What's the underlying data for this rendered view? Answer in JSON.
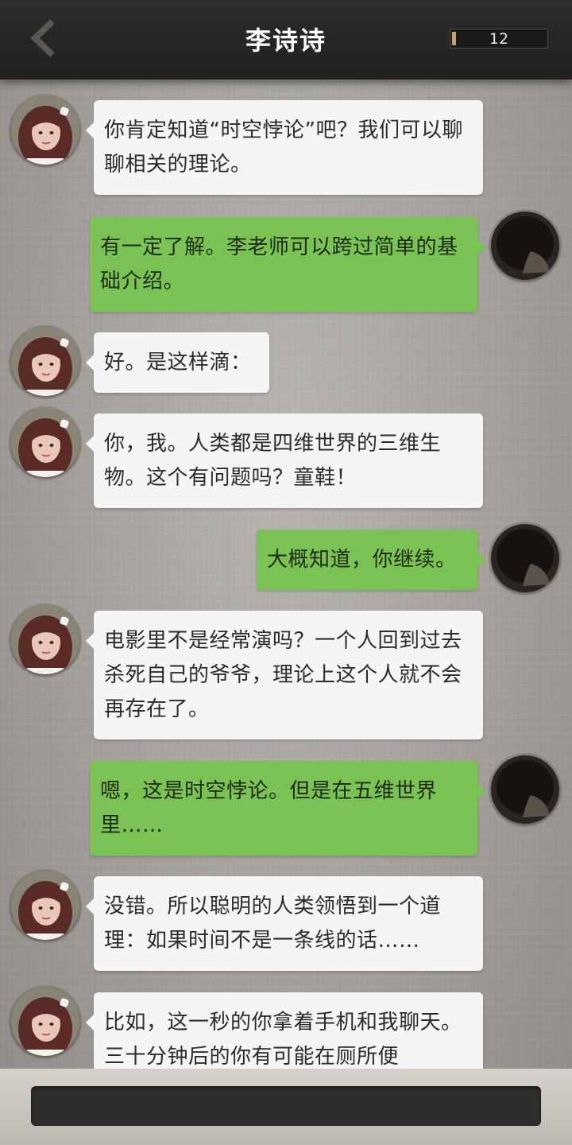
{
  "header": {
    "title": "李诗诗",
    "counter": "12",
    "back_icon": "chevron-left-icon"
  },
  "messages": [
    {
      "from": "her",
      "text": "你肯定知道“时空悖论”吧？我们可以聊聊相关的理论。"
    },
    {
      "from": "me",
      "text": "有一定了解。李老师可以跨过简单的基础介绍。"
    },
    {
      "from": "her",
      "text": "好。是这样滴："
    },
    {
      "from": "her",
      "text": "你，我。人类都是四维世界的三维生物。这个有问题吗？童鞋！"
    },
    {
      "from": "me",
      "text": "大概知道，你继续。"
    },
    {
      "from": "her",
      "text": "电影里不是经常演吗？一个人回到过去杀死自己的爷爷，理论上这个人就不会再存在了。"
    },
    {
      "from": "me",
      "text": "嗯，这是时空悖论。但是在五维世界里……"
    },
    {
      "from": "her",
      "text": "没错。所以聪明的人类领悟到一个道理：如果时间不是一条线的话……"
    },
    {
      "from": "her",
      "text": "比如，这一秒的你拿着手机和我聊天。三十分钟后的你有可能在厕所便"
    }
  ],
  "input": {
    "placeholder": ""
  },
  "colors": {
    "her_bubble": "#f5f5f5",
    "my_bubble": "#79c253",
    "header_bg": "#2a2826"
  }
}
